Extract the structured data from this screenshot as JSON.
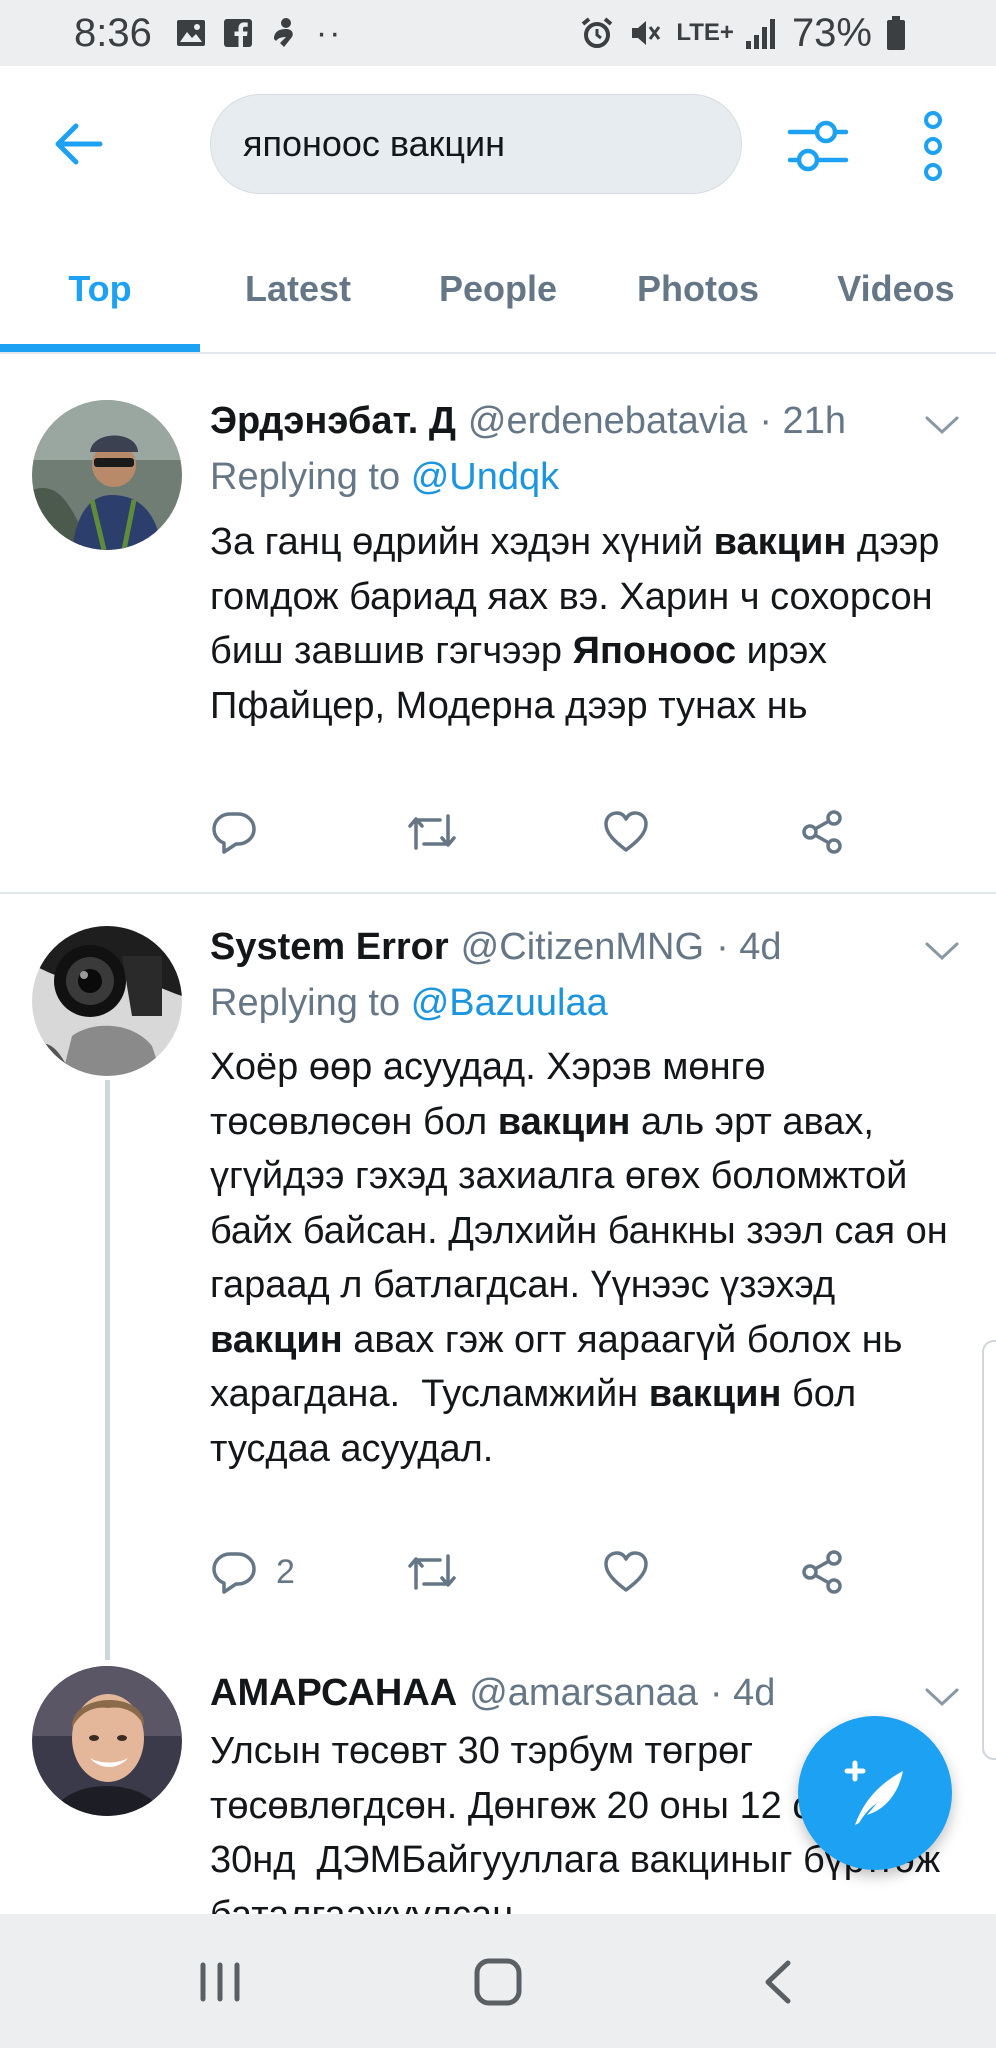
{
  "status_bar": {
    "time": "8:36",
    "more_dots": "··",
    "network": "LTE+",
    "battery": "73%"
  },
  "search": {
    "query": "японоос вакцин"
  },
  "tabs": [
    {
      "label": "Top",
      "active": true
    },
    {
      "label": "Latest",
      "active": false
    },
    {
      "label": "People",
      "active": false
    },
    {
      "label": "Photos",
      "active": false
    },
    {
      "label": "Videos",
      "active": false
    }
  ],
  "tweets": [
    {
      "name": "Эрдэнэбат. Д",
      "handle": "@erdenebatavia",
      "time": "· 21h",
      "reply_prefix": "Replying to",
      "reply_to": "@Undqk",
      "text_html": "За ганц өдрийн хэдэн хүний <b>вакцин</b> дээр гомдож бариад яах вэ. Харин ч сохорсон биш завшив гэгчээр <b>Японоос</b> ирэх Пфайцер, Модерна дээр тунах нь",
      "reply_count": ""
    },
    {
      "name": "System Error",
      "handle": "@CitizenMNG",
      "time": "· 4d",
      "reply_prefix": "Replying to",
      "reply_to": "@Bazuulaa",
      "text_html": "Хоёр өөр асуудад. Хэрэв мөнгө төсөвлөсөн бол <b>вакцин</b> аль эрт авах, үгүйдээ гэхэд захиалга өгөх боломжтой байх байсан. Дэлхийн банкны зээл сая он гараад л батлагдсан. Үүнээс үзэхэд <b>вакцин</b> авах гэж огт яараагүй болох нь харагдана.&nbsp; Тусламжийн <b>вакцин</b> бол тусдаа асуудал.",
      "reply_count": "2"
    },
    {
      "name": "АМАРСАНАА",
      "handle": "@amarsanaa",
      "time": "· 4d",
      "text_html": "Улсын төсөвт 30 тэрбум төгрөг төсөвлөгдсөн. Дөнгөж 20 оны 12 сарын 30нд&nbsp; ДЭМБайгууллага вакциныг бүртгэж баталгаажуулсан."
    }
  ]
}
